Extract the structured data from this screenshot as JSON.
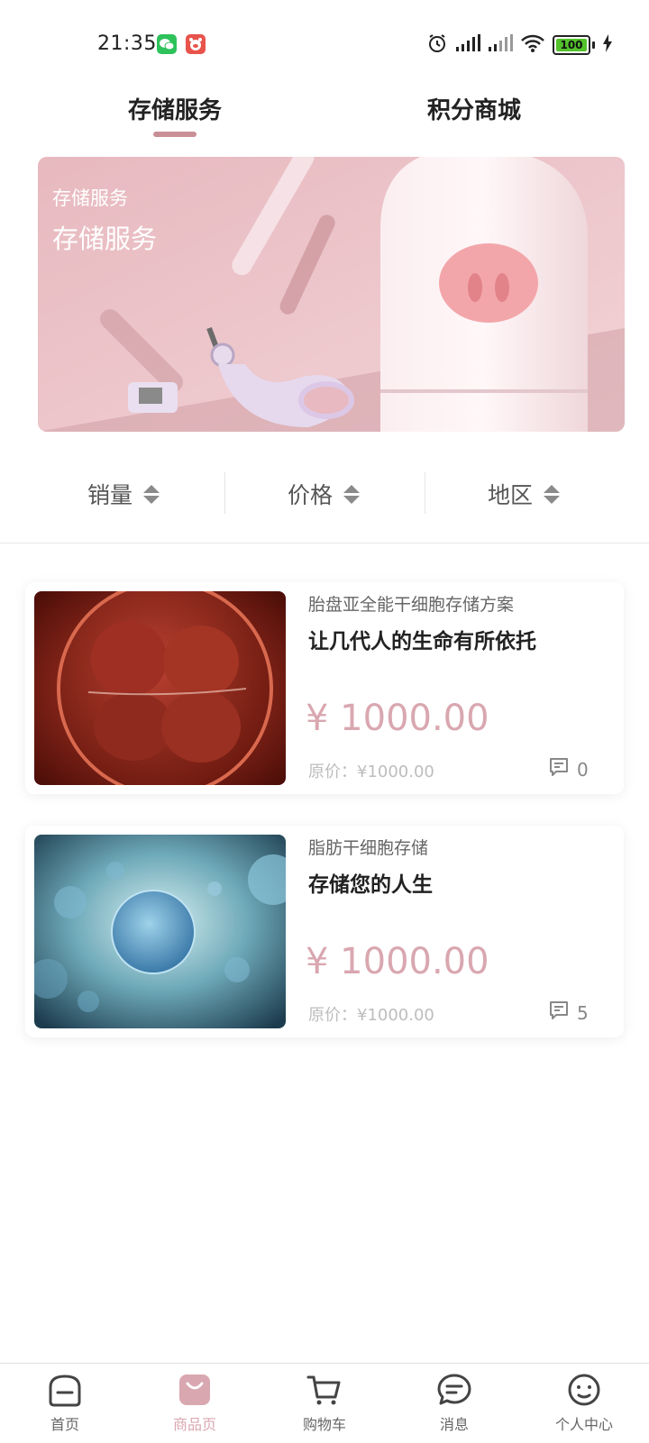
{
  "status_bar": {
    "time": "21:35",
    "battery": "100"
  },
  "tabs": [
    {
      "label": "存储服务",
      "active": true
    },
    {
      "label": "积分商城",
      "active": false
    }
  ],
  "banner": {
    "subtitle": "存储服务",
    "title": "存储服务"
  },
  "sort": {
    "sales": "销量",
    "price": "价格",
    "region": "地区"
  },
  "products": [
    {
      "category": "胎盘亚全能干细胞存储方案",
      "title": "让几代人的生命有所依托",
      "price": "¥ 1000.00",
      "original_price": "原价：¥1000.00",
      "comments": "0"
    },
    {
      "category": "脂肪干细胞存储",
      "title": "存储您的人生",
      "price": "¥ 1000.00",
      "original_price": "原价：¥1000.00",
      "comments": "5"
    }
  ],
  "bottom_nav": [
    {
      "label": "首页",
      "icon": "home-icon"
    },
    {
      "label": "商品页",
      "icon": "shopping-bag-icon",
      "active": true
    },
    {
      "label": "购物车",
      "icon": "cart-icon"
    },
    {
      "label": "消息",
      "icon": "message-icon"
    },
    {
      "label": "个人中心",
      "icon": "smiley-icon"
    }
  ],
  "colors": {
    "accent": "#d9a7b0",
    "tab_underline": "#c98f97"
  }
}
